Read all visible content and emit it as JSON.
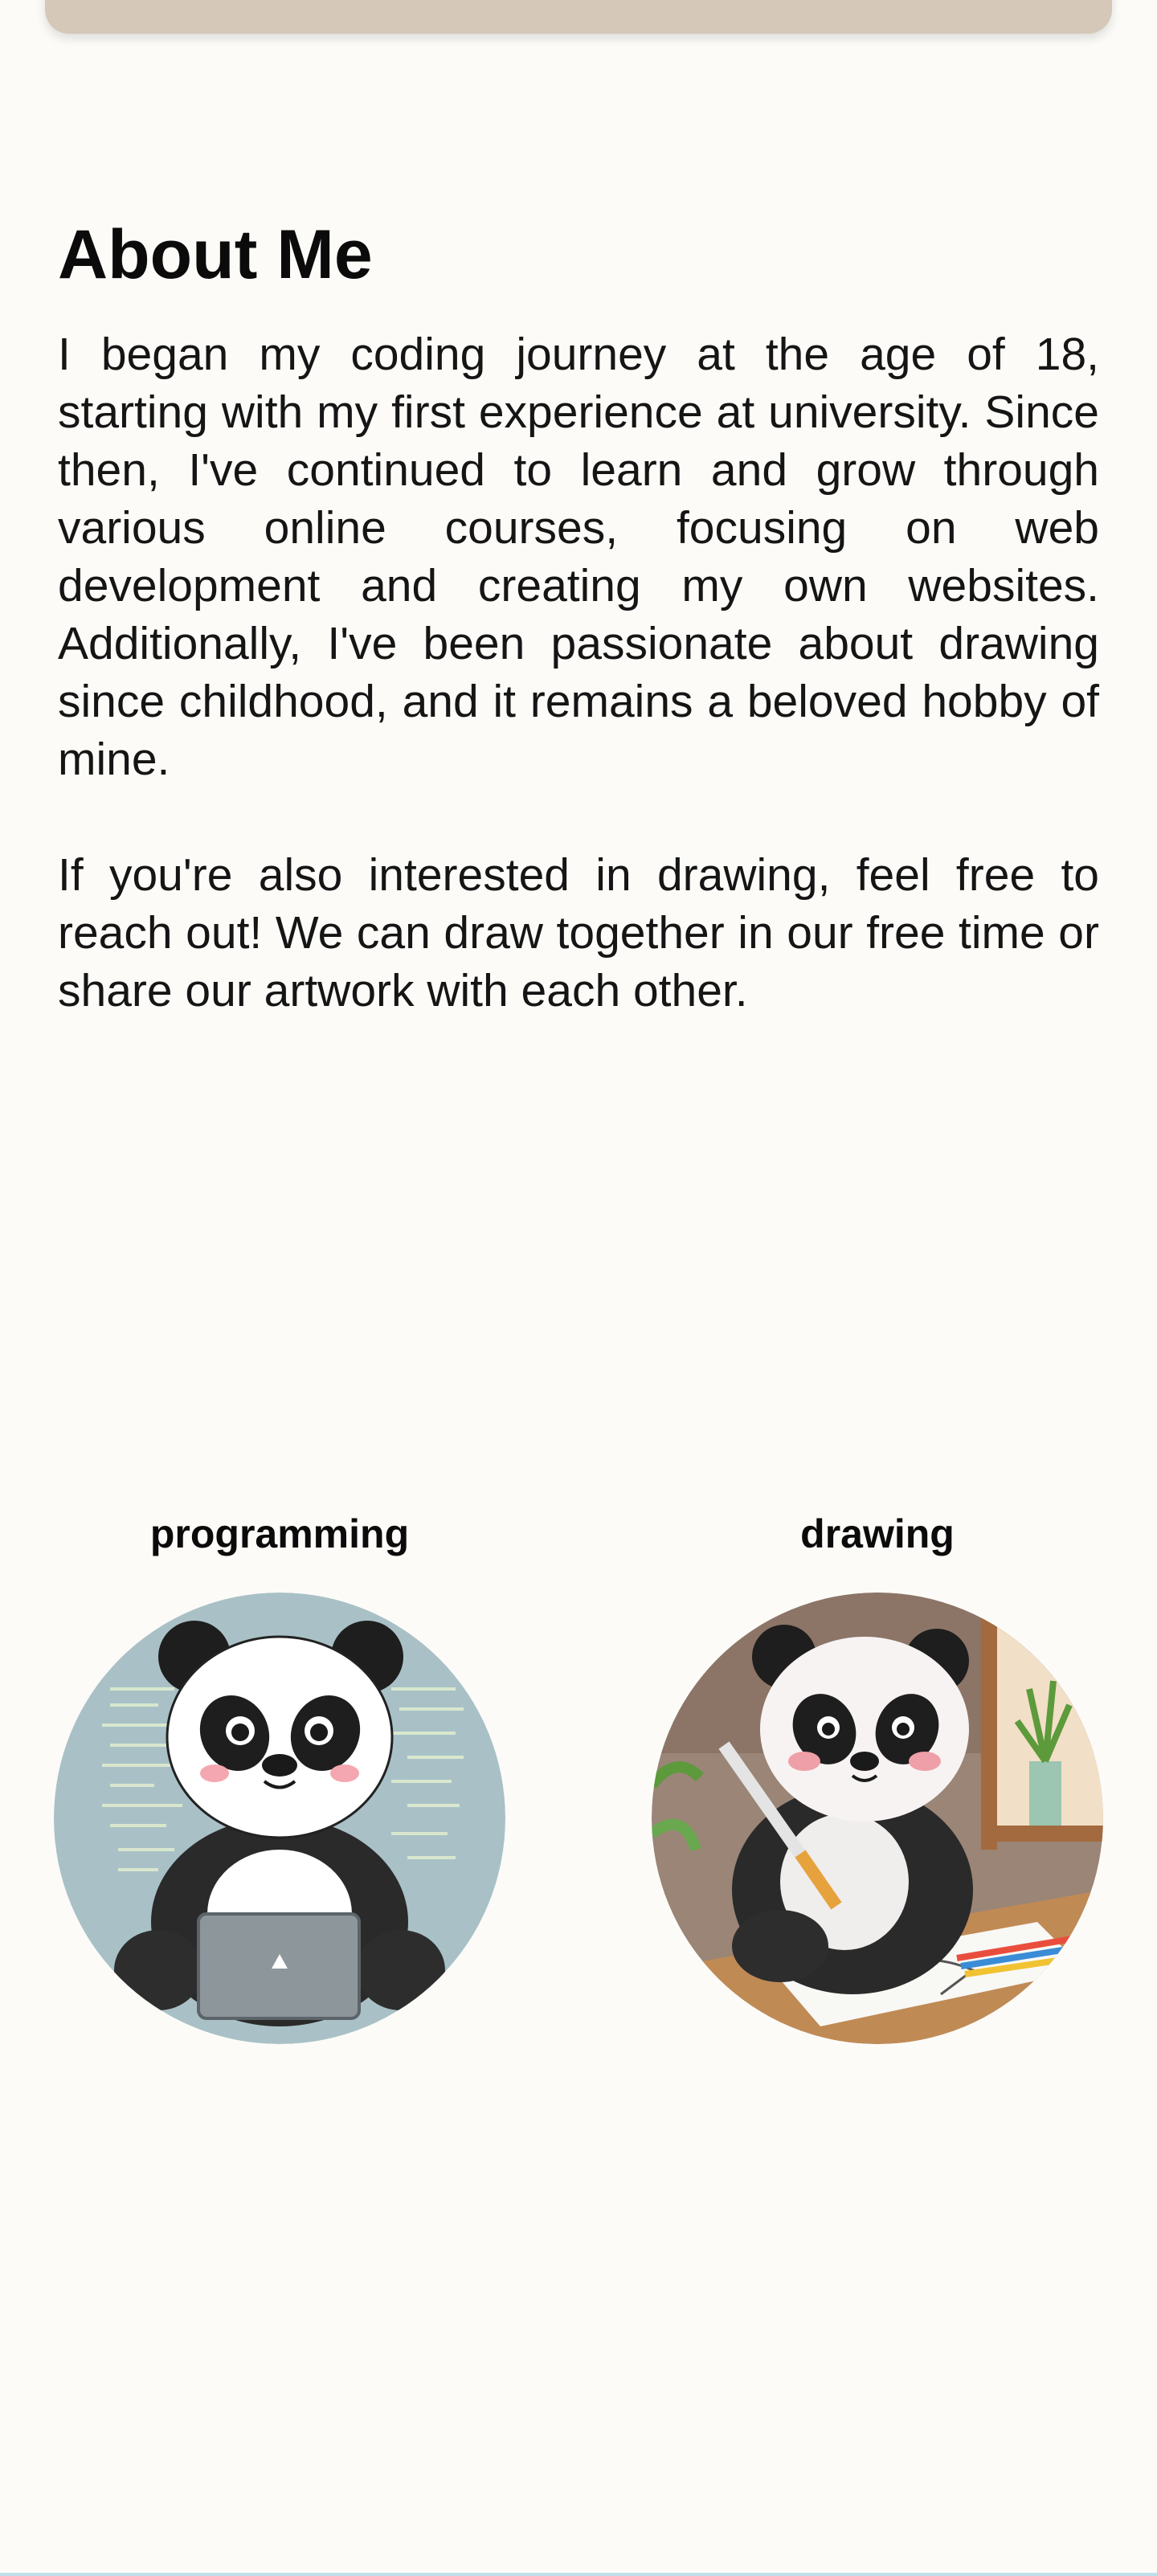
{
  "about": {
    "heading": "About Me",
    "paragraph1": "I began my coding journey at the age of 18, starting with my first experience at university. Since then, I've continued to learn and grow through various online courses, focusing on web development and creating my own websites. Additionally, I've been passionate about drawing since childhood, and it remains a beloved hobby of mine.",
    "paragraph2": "If you're also interested in drawing, feel free to reach out! We can draw together in our free time or share our artwork with each other."
  },
  "hobbies": [
    {
      "title": "programming",
      "image": "panda-with-laptop"
    },
    {
      "title": "drawing",
      "image": "panda-drawing"
    }
  ],
  "colors": {
    "background": "#fcfbf8",
    "top_bar": "#d5c8b8",
    "text": "#111111"
  }
}
